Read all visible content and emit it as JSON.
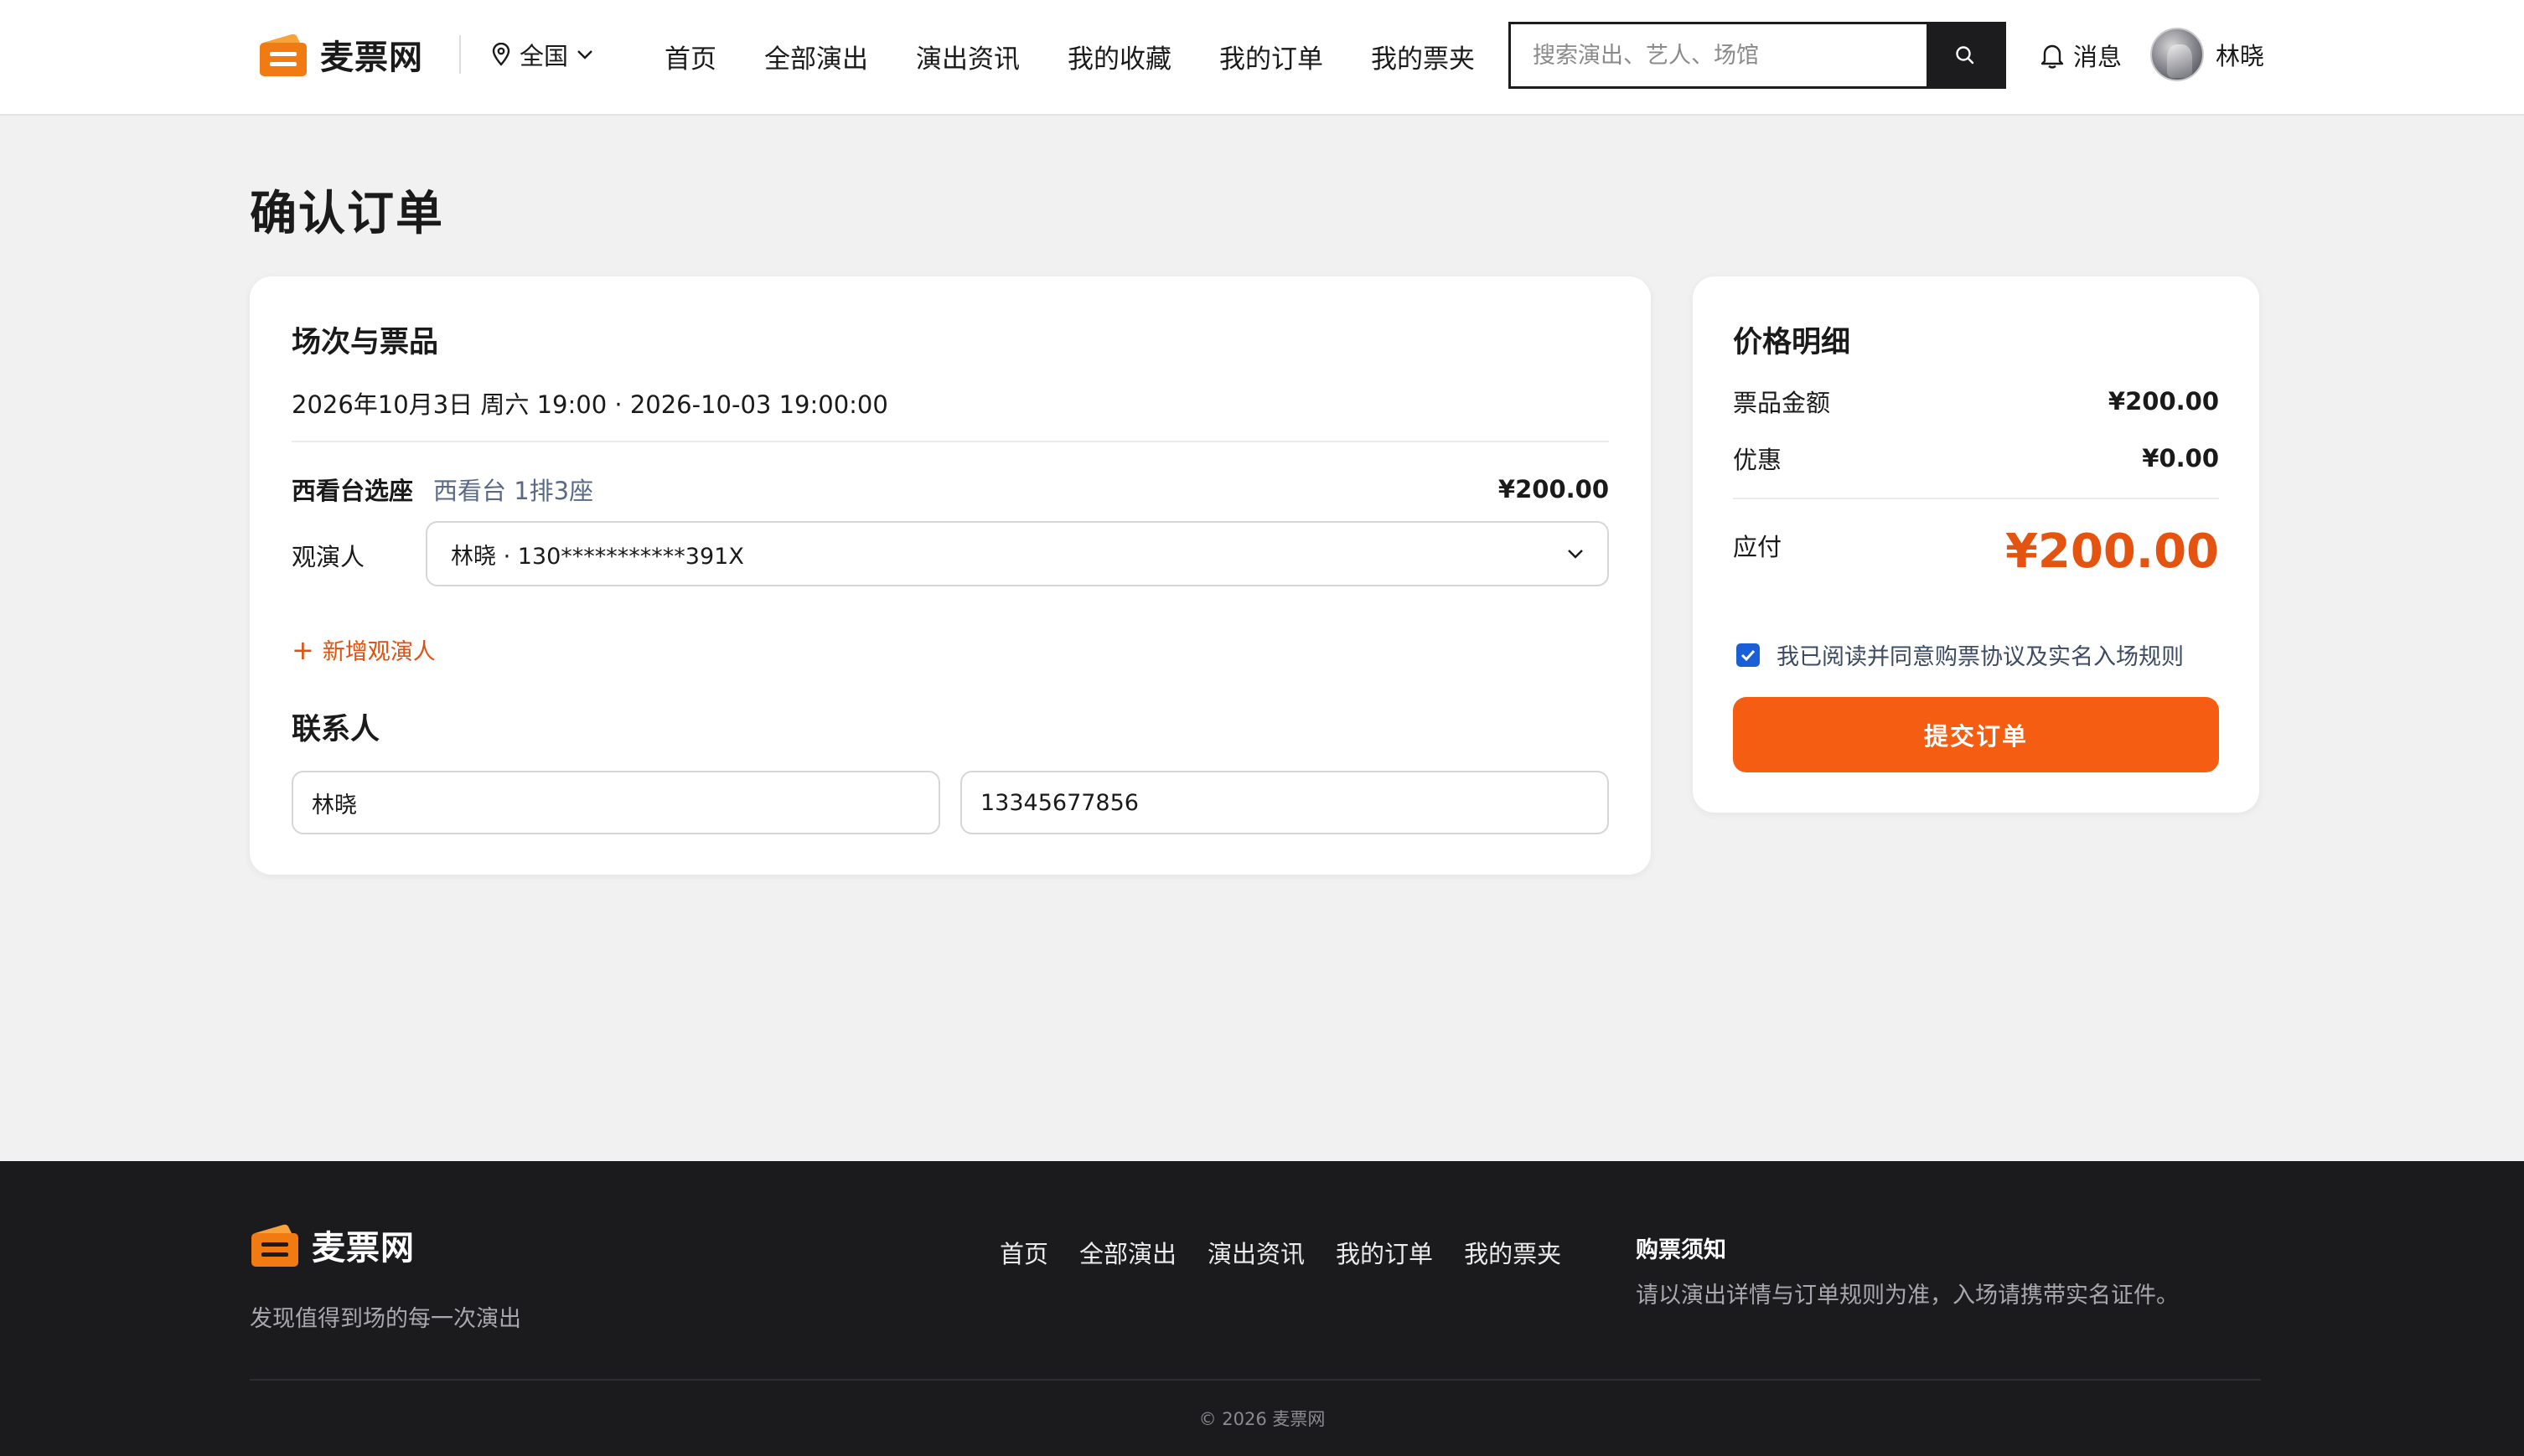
{
  "brand": {
    "name": "麦票网",
    "accent": "#f55e12",
    "icon": "ticket-stack-icon"
  },
  "header": {
    "city": "全国",
    "nav": [
      "首页",
      "全部演出",
      "演出资讯",
      "我的收藏",
      "我的订单",
      "我的票夹"
    ],
    "search": {
      "placeholder": "搜索演出、艺人、场馆",
      "value": ""
    },
    "messages_label": "消息",
    "user_name": "林晓"
  },
  "page": {
    "title": "确认订单"
  },
  "order": {
    "section_title": "场次与票品",
    "session_line": "2026年10月3日 周六 19:00 · 2026-10-03 19:00:00",
    "ticket": {
      "name": "西看台选座",
      "seat": "西看台 1排3座",
      "price": "¥200.00"
    },
    "viewer_label": "观演人",
    "viewer_selected": "林晓 · 130***********391X",
    "add_viewer": "新增观演人",
    "contact_title": "联系人",
    "contact_name": "林晓",
    "contact_phone": "13345677856"
  },
  "price": {
    "title": "价格明细",
    "ticket_amount_label": "票品金额",
    "ticket_amount": "¥200.00",
    "discount_label": "优惠",
    "discount": "¥0.00",
    "payable_label": "应付",
    "payable": "¥200.00",
    "agreement": "我已阅读并同意购票协议及实名入场规则",
    "agreement_checked": true,
    "submit_label": "提交订单"
  },
  "footer": {
    "tagline": "发现值得到场的每一次演出",
    "nav": [
      "首页",
      "全部演出",
      "演出资讯",
      "我的订单",
      "我的票夹"
    ],
    "notice_title": "购票须知",
    "notice_text": "请以演出详情与订单规则为准，入场请携带实名证件。",
    "copyright": "© 2026 麦票网"
  }
}
